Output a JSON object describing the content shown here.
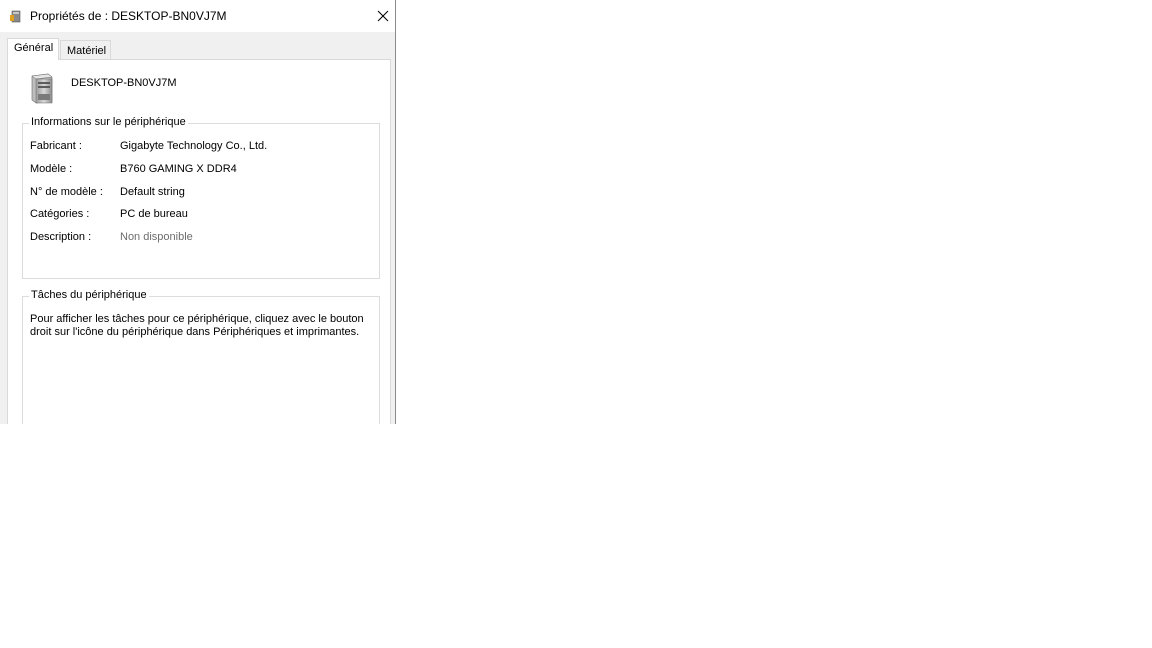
{
  "window": {
    "title": "Propriétés de : DESKTOP-BN0VJ7M",
    "title_icon": "computer-icon",
    "close_icon": "close-icon"
  },
  "tabs": [
    {
      "label": "Général",
      "active": true
    },
    {
      "label": "Matériel",
      "active": false
    }
  ],
  "general": {
    "device_icon": "computer-tower-icon",
    "device_name": "DESKTOP-BN0VJ7M",
    "info_group": {
      "legend": "Informations sur le périphérique",
      "rows": [
        {
          "label": "Fabricant :",
          "value": "Gigabyte Technology Co., Ltd."
        },
        {
          "label": "Modèle :",
          "value": "B760 GAMING X DDR4"
        },
        {
          "label": "N° de modèle :",
          "value": "Default string"
        },
        {
          "label": "Catégories :",
          "value": "PC de bureau"
        },
        {
          "label": "Description :",
          "value": "Non disponible"
        }
      ]
    },
    "tasks_group": {
      "legend": "Tâches du périphérique",
      "text": "Pour afficher les tâches pour ce périphérique, cliquez avec le bouton droit sur l'icône du périphérique dans Périphériques et imprimantes."
    }
  },
  "colors": {
    "window_bg": "#f0f0f0",
    "panel_bg": "#ffffff",
    "border": "#d9d9d9",
    "muted_text": "#6d6d6d"
  }
}
